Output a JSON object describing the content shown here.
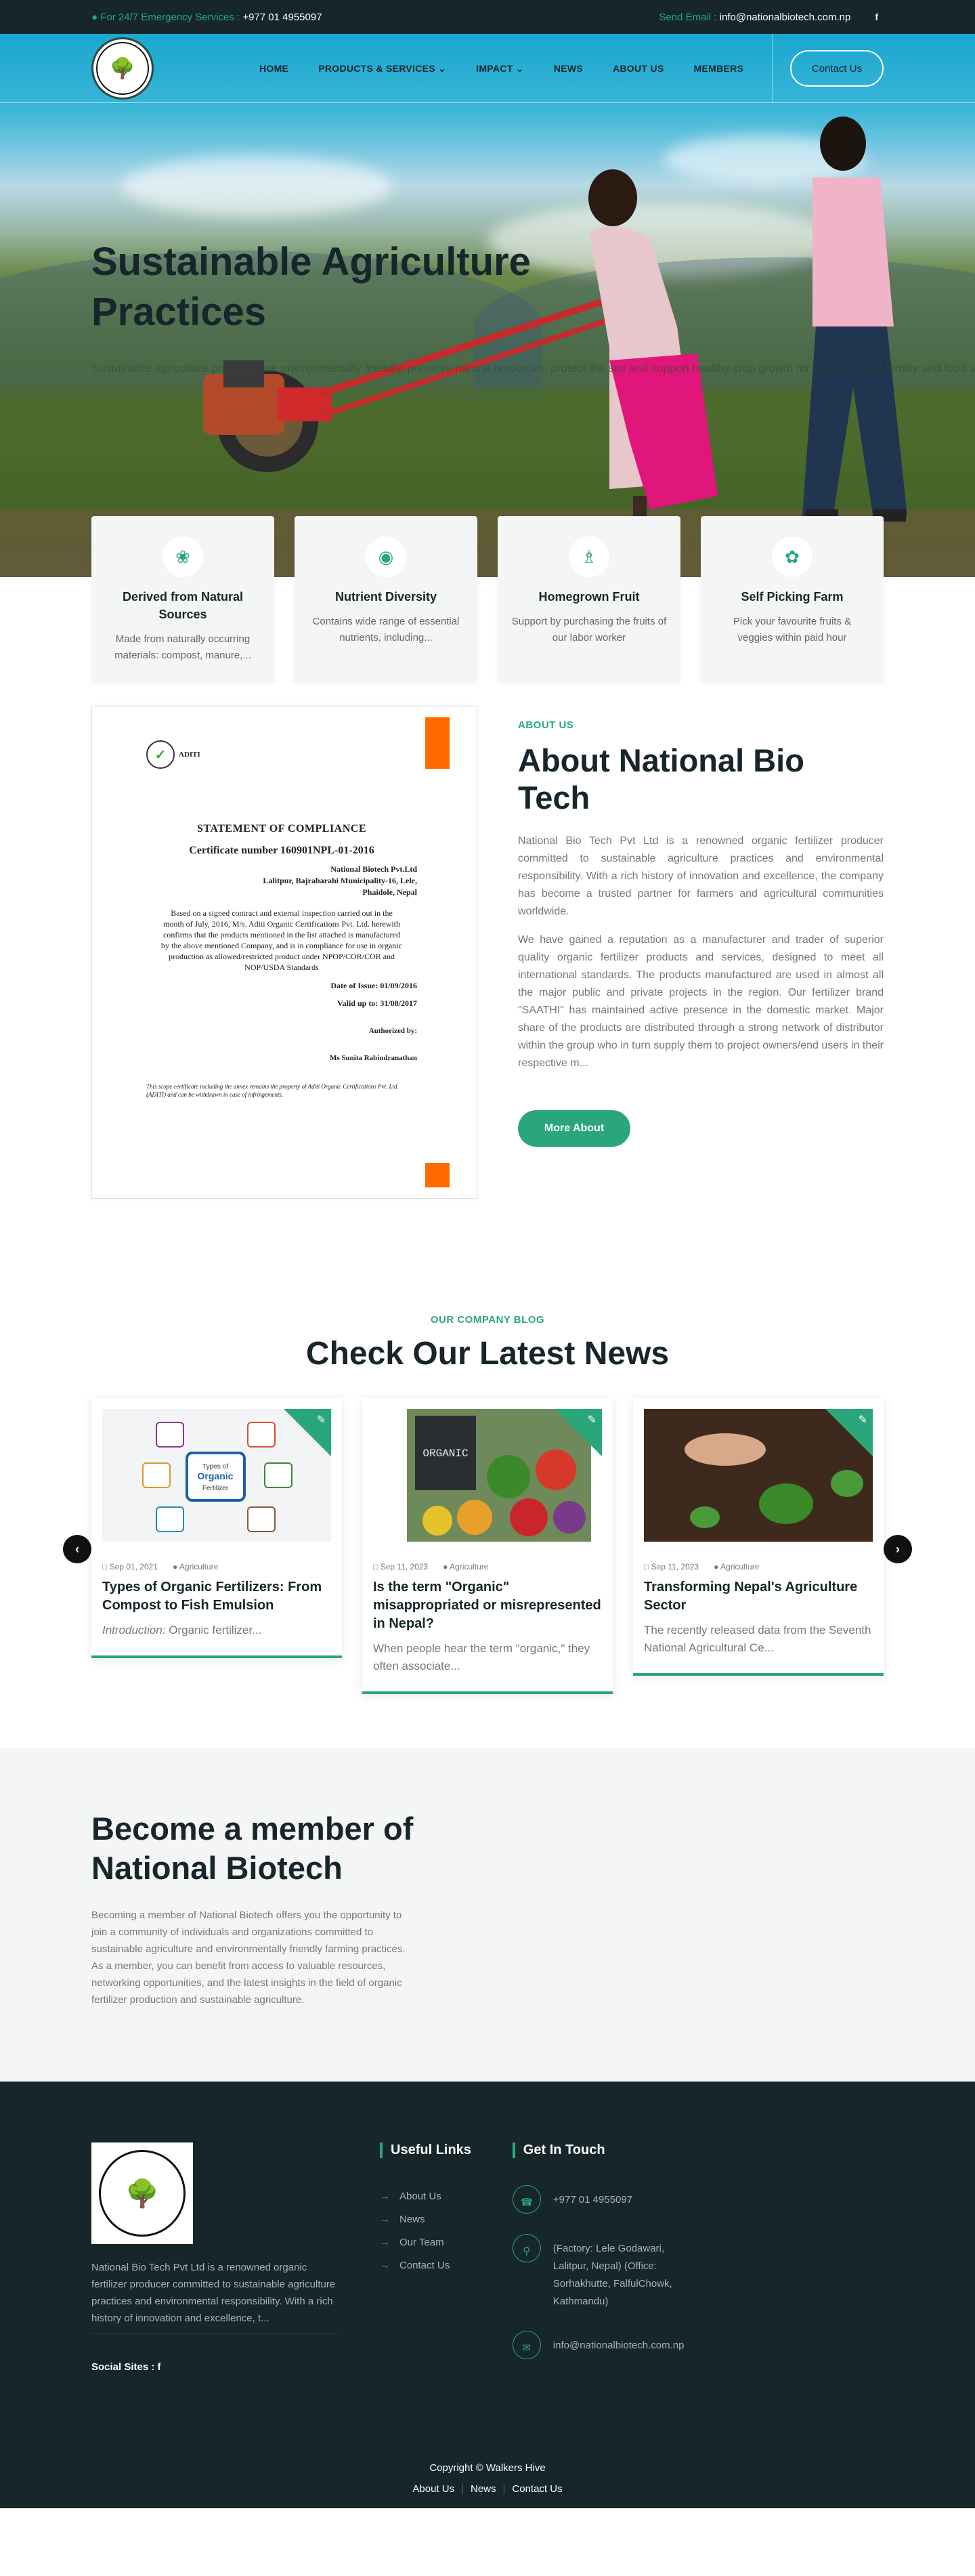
{
  "topbar": {
    "emergency_label": "For 24/7 Emergency Services :",
    "phone": "+977 01 4955097",
    "email_label": "Send Email :",
    "email": "info@nationalbiotech.com.np",
    "social": "f"
  },
  "nav": {
    "items": [
      "HOME",
      "PRODUCTS & SERVICES",
      "IMPACT",
      "NEWS",
      "ABOUT US",
      "MEMBERS"
    ],
    "contact_button": "Contact Us"
  },
  "hero": {
    "title": "Sustainable Agriculture Practices",
    "subtitle": "Sustainable agriculture practices are environmentally friendly, preserve natural resources, protect the soil and support healthy crop growth for long-term soil fertility and food security."
  },
  "features": [
    {
      "icon": "leaf-icon",
      "title": "Derived from Natural Sources",
      "text": "Made from naturally occurring materials: compost, manure,..."
    },
    {
      "icon": "nutrient-icon",
      "title": "Nutrient Diversity",
      "text": "Contains wide range of essential nutrients, including..."
    },
    {
      "icon": "farmer-icon",
      "title": "Homegrown Fruit",
      "text": "Support by purchasing the fruits of our labor worker"
    },
    {
      "icon": "picking-icon",
      "title": "Self Picking Farm",
      "text": "Pick your favourite fruits & veggies within paid hour"
    }
  ],
  "certificate": {
    "org": "ADITI",
    "heading": "STATEMENT OF COMPLIANCE",
    "number": "Certificate number 160901NPL-01-2016",
    "address": [
      "National Biotech Pvt.Ltd",
      "Lalitpur, Bajrabarahi Municipality-16, Lele,",
      "Phaidole, Nepal"
    ],
    "body": "Based on a signed contract and external inspection carried out in the month of July, 2016, M/s. Aditi Organic Certifications Pvt. Ltd. herewith confirms that the products mentioned in the list attached is manufactured by the above mentioned Company, and is in compliance for use in organic production as allowed/restricted product under NPOP/COR/COR and NOP/USDA Standards",
    "issue": "Date of Issue: 01/09/2016",
    "valid": "Valid up to: 31/08/2017",
    "signer": "Authorized by:",
    "signer_name": "Ms Sunita Rabindranathan",
    "fine": "This scope certificate including the annex remains the property of Aditi Organic Certifications Pvt. Ltd. (ADITI) and can be withdrawn in case of infringements."
  },
  "about": {
    "kicker": "ABOUT US",
    "title": "About National Bio Tech",
    "p1": "National Bio Tech Pvt Ltd is a renowned organic fertilizer producer committed to sustainable agriculture practices and environmental responsibility. With a rich history of innovation and excellence, the company has become a trusted partner for farmers and agricultural communities worldwide.",
    "p2": "We have gained a reputation as a manufacturer and trader of superior quality organic fertilizer products and services, designed to meet all international standards. The products manufactured are used in almost all the major public and private projects in the region. Our fertilizer brand \"SAATHI\" has maintained active presence in the domestic market. Major share of the products are distributed through a strong network of distributor within the group who in turn supply them to project owners/end users in their respective m...",
    "button": "More About"
  },
  "blog": {
    "kicker": "OUR COMPANY BLOG",
    "title": "Check Our Latest News",
    "posts": [
      {
        "date": "Sep 01, 2021",
        "category": "Agriculture",
        "title": "Types of Organic Fertilizers: From Compost to Fish Emulsion",
        "excerpt_em": "Introduction:",
        "excerpt": " Organic fertilizer..."
      },
      {
        "date": "Sep 11, 2023",
        "category": "Agriculture",
        "title": "Is the term \"Organic\" misappropriated or misrepresented in Nepal?",
        "excerpt_em": "",
        "excerpt": "When people hear the term \"organic,\" they often associate..."
      },
      {
        "date": "Sep 11, 2023",
        "category": "Agriculture",
        "title": "Transforming Nepal's Agriculture Sector",
        "excerpt_em": "",
        "excerpt": "The recently released data from the Seventh National Agricultural Ce..."
      }
    ],
    "thumb1_labels": [
      "Types of",
      "Organic",
      "Fertilizer"
    ],
    "thumb2_label": "ORGANIC"
  },
  "member": {
    "title": "Become a member of National Biotech",
    "text": "Becoming a member of National Biotech offers you the opportunity to join a community of individuals and organizations committed to sustainable agriculture and environmentally friendly farming practices. As a member, you can benefit from access to valuable resources, networking opportunities, and the latest insights in the field of organic fertilizer production and sustainable agriculture."
  },
  "footer": {
    "about": "National Bio Tech Pvt Ltd is a renowned organic fertilizer producer committed to sustainable agriculture practices and environmental responsibility. With a rich history of innovation and excellence, t...",
    "social_label": "Social Sites :",
    "social": "f",
    "useful_title": "Useful Links",
    "links": [
      "About Us",
      "News",
      "Our Team",
      "Contact Us"
    ],
    "touch_title": "Get In Touch",
    "phone": "+977 01 4955097",
    "address": "(Factory: Lele Godawari, Lalitpur, Nepal) (Office: Sorhakhutte, FalfulChowk, Kathmandu)",
    "email": "info@nationalbiotech.com.np",
    "copyright": "Copyright © Walkers Hive",
    "bottom_links": [
      "About Us",
      "News",
      "Contact Us"
    ]
  },
  "colors": {
    "accent": "#2aa77a",
    "dark": "#16262a",
    "cta_orange": "#ff6a00"
  }
}
